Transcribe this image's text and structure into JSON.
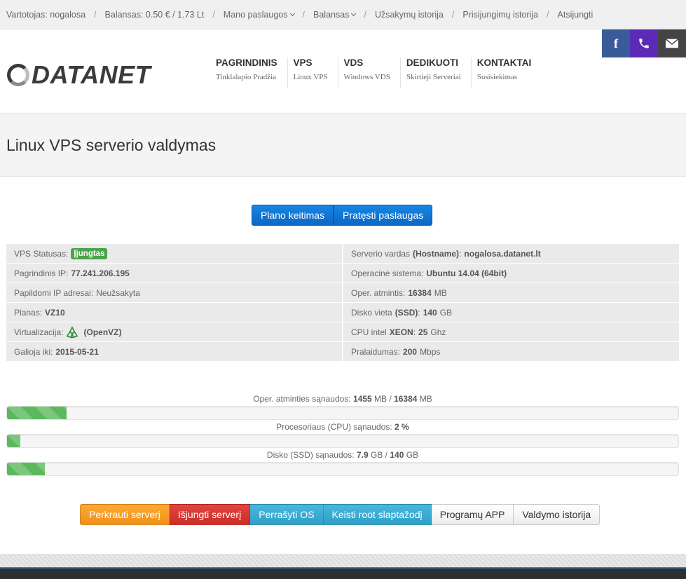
{
  "topbar": {
    "user": "Vartotojas: nogalosa",
    "balance": "Balansas: 0.50 € / 1.73 Lt",
    "my_services": "Mano paslaugos",
    "balance_menu": "Balansas",
    "order_history": "Užsakymų istorija",
    "login_history": "Prisijungimų istorija",
    "logout": "Atsijungti",
    "separator": "/"
  },
  "logo": {
    "text": "DATANET"
  },
  "nav": [
    {
      "title": "Pagrindinis",
      "sub": "Tinklalapio Pradžia"
    },
    {
      "title": "VPS",
      "sub": "Linux VPS"
    },
    {
      "title": "VDS",
      "sub": "Windows VDS"
    },
    {
      "title": "Dedikuoti",
      "sub": "Skirtieji Serveriai"
    },
    {
      "title": "Kontaktai",
      "sub": "Susisiekimas"
    }
  ],
  "social": {
    "facebook_glyph": "f"
  },
  "page": {
    "title": "Linux VPS serverio valdymas"
  },
  "top_buttons": {
    "change_plan": "Plano keitimas",
    "extend": "Pratęsti paslaugas"
  },
  "info_left": {
    "status_label": "VPS Statusas:",
    "status_value": "Įjungtas",
    "ip_label": "Pagrindinis IP:",
    "ip_value": "77.241.206.195",
    "extra_ip_label": "Papildomi IP adresai:",
    "extra_ip_value": "Neužsakyta",
    "plan_label": "Planas:",
    "plan_value": "VZ10",
    "virt_label": "Virtualizacija:",
    "virt_value": "(OpenVZ)",
    "valid_label": "Galioja iki:",
    "valid_value": "2015-05-21"
  },
  "info_right": {
    "hostname_label": "Serverio vardas",
    "hostname_key": "(Hostname)",
    "hostname_value": "nogalosa.datanet.lt",
    "os_label": "Operacinė sistema:",
    "os_value": "Ubuntu 14.04 (64bit)",
    "ram_label": "Oper. atmintis:",
    "ram_value": "16384",
    "ram_unit": "MB",
    "disk_label": "Disko vieta",
    "disk_key": "(SSD)",
    "disk_value": "140",
    "disk_unit": "GB",
    "cpu_label": "CPU intel",
    "cpu_key": "XEON",
    "cpu_value": "25",
    "cpu_unit": "Ghz",
    "bw_label": "Pralaidumas:",
    "bw_value": "200",
    "bw_unit": "Mbps"
  },
  "usage": {
    "ram": {
      "label": "Oper. atminties sąnaudos:",
      "used": "1455",
      "unit1": "MB /",
      "total": "16384",
      "unit2": "MB",
      "percent": 8.9
    },
    "cpu": {
      "label": "Procesoriaus (CPU) sąnaudos:",
      "value": "2 %",
      "percent": 2
    },
    "disk": {
      "label": "Disko (SSD) sąnaudos:",
      "used": "7.9",
      "unit1": "GB /",
      "total": "140",
      "unit2": "GB",
      "percent": 5.6
    }
  },
  "bottom_buttons": {
    "reboot": "Perkrauti serverį",
    "shutdown": "Išjungti serverį",
    "reinstall": "Perrašyti OS",
    "root_pw": "Keisti root slaptažodį",
    "apps": "Programų APP",
    "history": "Valdymo istorija"
  },
  "colors": {
    "brand_blue": "#0d67c4",
    "progress_green": "#5cb85c",
    "status_green": "#4aa44a",
    "facebook": "#3b5a9a",
    "phone": "#5b2bb5",
    "mail": "#444444"
  }
}
